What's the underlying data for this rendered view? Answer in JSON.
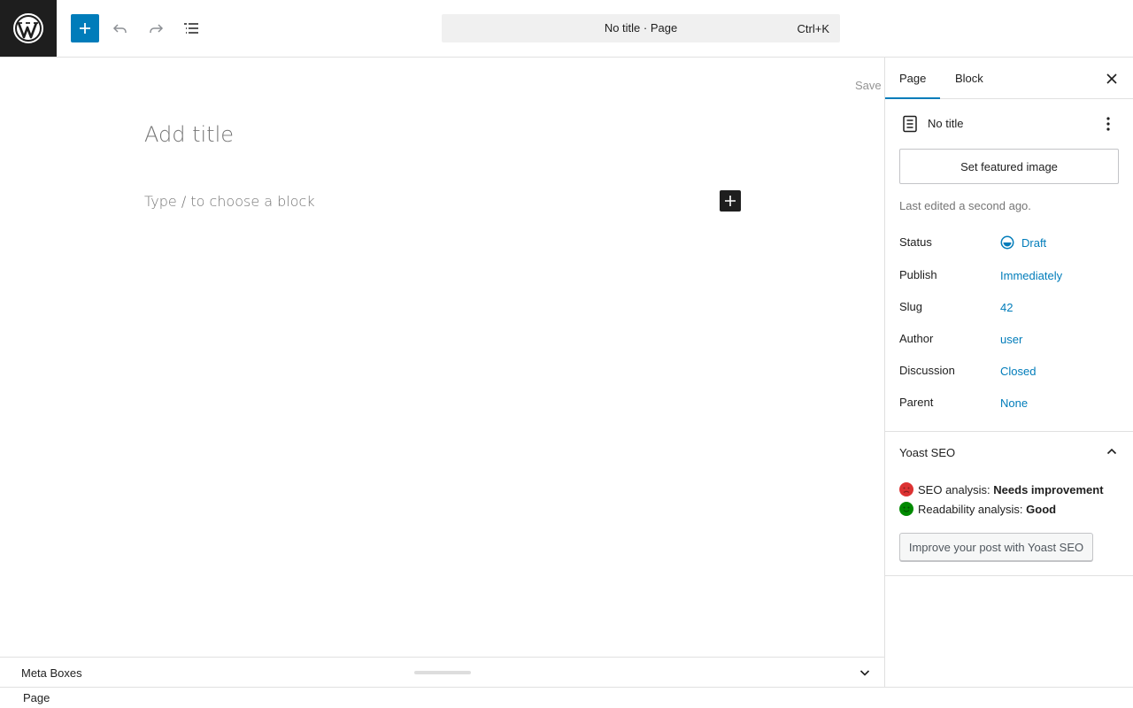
{
  "header": {
    "command_title": "No title · Page",
    "command_shortcut": "Ctrl+K"
  },
  "editor": {
    "save_label": "Save",
    "title_placeholder": "Add title",
    "block_placeholder": "Type / to choose a block"
  },
  "sidebar": {
    "tabs": [
      {
        "label": "Page",
        "active": true
      },
      {
        "label": "Block",
        "active": false
      }
    ],
    "doc_title": "No title",
    "featured_image_label": "Set featured image",
    "last_edited": "Last edited a second ago.",
    "meta": [
      {
        "label": "Status",
        "value": "Draft"
      },
      {
        "label": "Publish",
        "value": "Immediately"
      },
      {
        "label": "Slug",
        "value": "42"
      },
      {
        "label": "Author",
        "value": "user"
      },
      {
        "label": "Discussion",
        "value": "Closed"
      },
      {
        "label": "Parent",
        "value": "None"
      }
    ]
  },
  "yoast": {
    "title": "Yoast SEO",
    "seo_label": "SEO analysis:",
    "seo_value": "Needs improvement",
    "readability_label": "Readability analysis:",
    "readability_value": "Good",
    "improve_button": "Improve your post with Yoast SEO",
    "colors": {
      "bad": "#dc3232",
      "good": "#008a00"
    }
  },
  "metaboxes": {
    "title": "Meta Boxes"
  },
  "footer": {
    "breadcrumb": "Page"
  },
  "colors": {
    "accent": "#007cba",
    "dark": "#1e1e1e"
  }
}
